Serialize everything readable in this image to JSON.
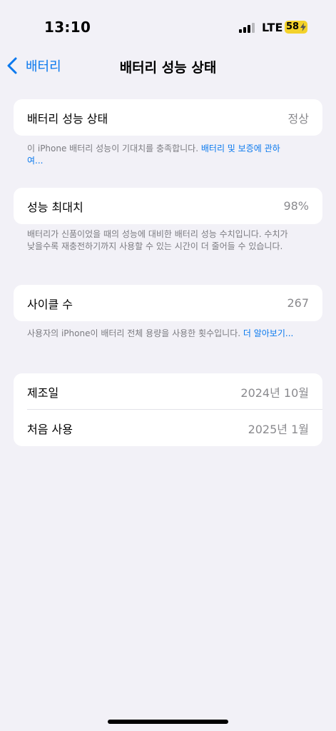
{
  "status_bar": {
    "time": "13:10",
    "network": "LTE",
    "battery": "58"
  },
  "nav": {
    "back_label": "배터리",
    "title": "배터리 성능 상태"
  },
  "health": {
    "label": "배터리 성능 상태",
    "value": "정상",
    "footnote_text": "이 iPhone 배터리 성능이 기대치를 충족합니다. ",
    "footnote_link": "배터리 및 보증에 관하여..."
  },
  "capacity": {
    "label": "성능 최대치",
    "value": "98%",
    "footnote": "배터리가 신품이었을 때의 성능에 대비한 배터리 성능 수치입니다. 수치가 낮을수록 재충전하기까지 사용할 수 있는 시간이 더 줄어들 수 있습니다."
  },
  "cycles": {
    "label": "사이클 수",
    "value": "267",
    "footnote_text": "사용자의 iPhone이 배터리 전체 용량을 사용한 횟수입니다. ",
    "footnote_link": "더 알아보기..."
  },
  "dates": {
    "manufactured_label": "제조일",
    "manufactured_value": "2024년 10월",
    "first_use_label": "처음 사용",
    "first_use_value": "2025년 1월"
  }
}
